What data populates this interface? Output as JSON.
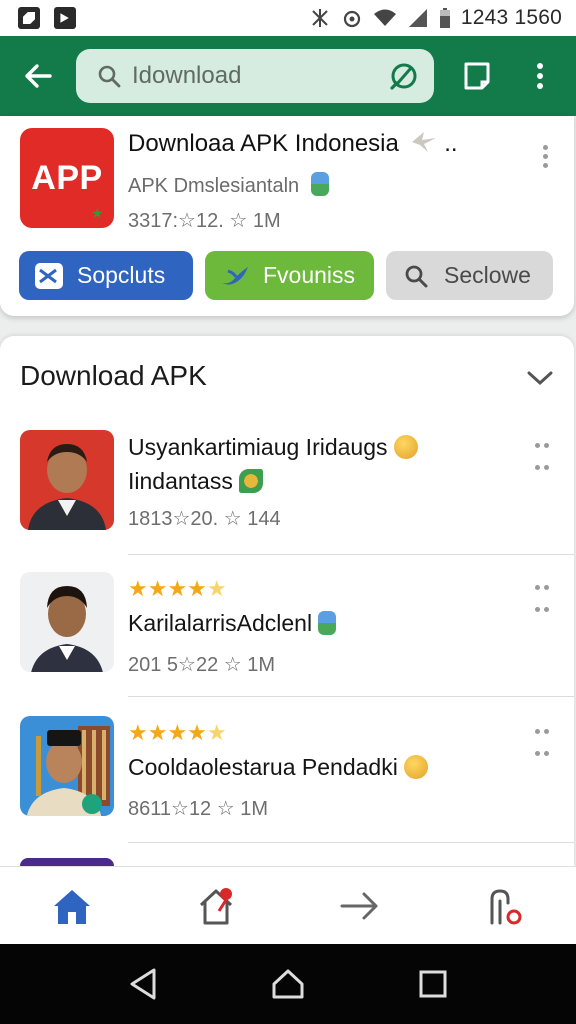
{
  "status_bar": {
    "time": "1243 1560"
  },
  "search": {
    "query": "Idownload"
  },
  "featured_app": {
    "logo_text": "APP",
    "title": "Downloaa APK Indonesia",
    "subtitle": "APK Dmslesiantaln",
    "meta": "3317:☆12. ☆ 1M"
  },
  "chips": [
    {
      "label": "Sopcluts",
      "color": "#2f64c0"
    },
    {
      "label": "Fvouniss",
      "color": "#6cb93c"
    },
    {
      "label": "Seclowe",
      "color": "#d9d9d9"
    }
  ],
  "section": {
    "title": "Download APK"
  },
  "list": [
    {
      "title_line1": "Usyankartimiaug Iridaugs",
      "title_line2": "Iindantass",
      "meta": "1813☆20. ☆ 144"
    },
    {
      "stars": "★★★★",
      "rating": 4.5,
      "title": "KarilalarrisAdclenl",
      "meta": "201 5☆22 ☆ 1M"
    },
    {
      "stars": "★★★★",
      "rating": 4.5,
      "title": "Cooldaolestarua Pendadki",
      "meta": "8611☆12 ☆ 1M"
    }
  ],
  "icons": {
    "back": "arrow-left-icon",
    "search": "search-icon",
    "voice": "voice-search-icon",
    "tabs": "tabs-icon",
    "more": "more-vert-icon",
    "nav": [
      "home-icon",
      "updates-icon",
      "forward-icon",
      "account-icon"
    ],
    "system": [
      "back-triangle-icon",
      "home-house-icon",
      "recents-square-icon"
    ]
  },
  "colors": {
    "app_bar": "#137a4a",
    "accent_blue": "#2f64c0",
    "accent_green": "#6cb93c",
    "logo_red": "#e02b27"
  }
}
